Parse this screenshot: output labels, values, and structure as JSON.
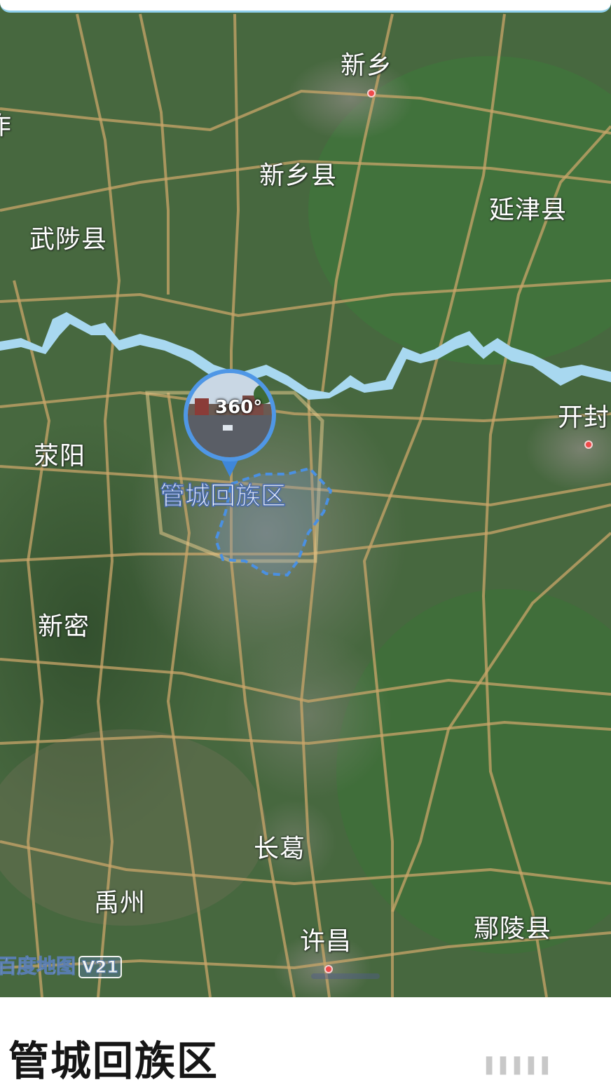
{
  "map": {
    "places": [
      {
        "id": "xinxiang",
        "label": "新乡",
        "city": true
      },
      {
        "id": "xinxiangxian",
        "label": "新乡县",
        "city": false
      },
      {
        "id": "yanjinxian",
        "label": "延津县",
        "city": false
      },
      {
        "id": "wuzhixian",
        "label": "武陟县",
        "city": false
      },
      {
        "id": "kaifeng",
        "label": "开封",
        "city": true
      },
      {
        "id": "xingyang",
        "label": "荥阳",
        "city": false
      },
      {
        "id": "xinmi",
        "label": "新密",
        "city": false
      },
      {
        "id": "changge",
        "label": "长葛",
        "city": false
      },
      {
        "id": "yuzhou",
        "label": "禹州",
        "city": false
      },
      {
        "id": "xuchang",
        "label": "许昌",
        "city": true
      },
      {
        "id": "yanlingxian",
        "label": "鄢陵县",
        "city": false
      },
      {
        "id": "edge_left",
        "label": "作",
        "city": false
      }
    ],
    "selected_district": "管城回族区",
    "panorama_badge": "360°",
    "watermark": {
      "brand": "百度地图",
      "version": "V21"
    },
    "colors": {
      "river": "#a8d8f0",
      "road": "#c9a56a",
      "boundary": "#4a90e2",
      "city_dot": "#ee4a4a"
    }
  },
  "sheet": {
    "title": "管城回族区",
    "footer": "▌▌▌▌▌"
  }
}
